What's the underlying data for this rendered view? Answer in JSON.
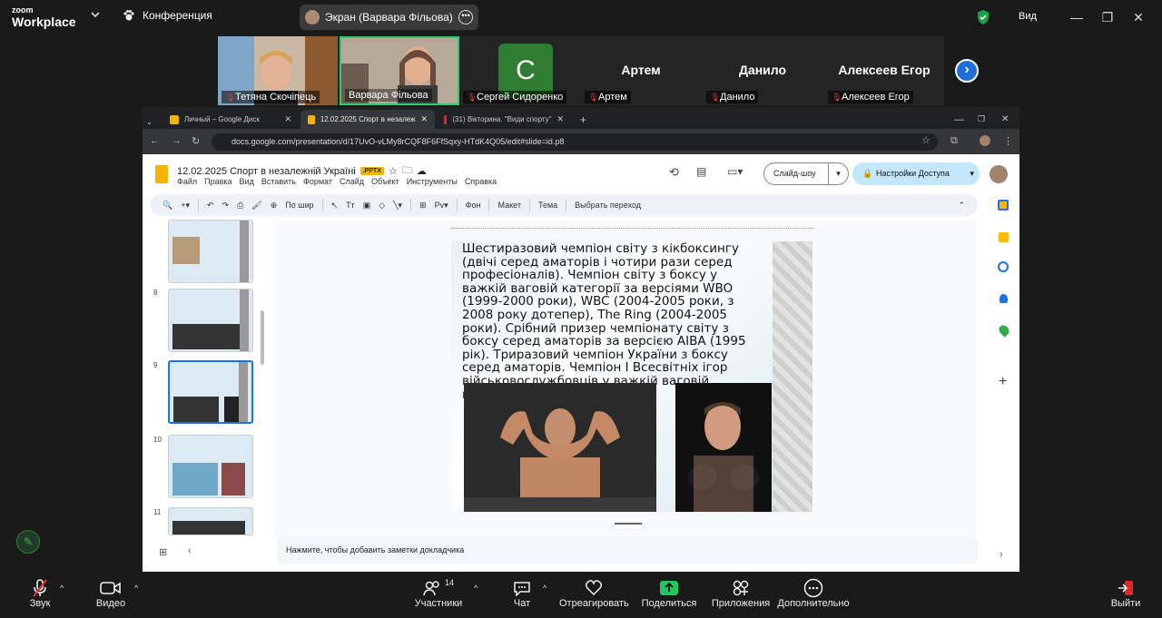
{
  "zoom": {
    "logo_top": "zoom",
    "logo_bottom": "Workplace",
    "meeting_title": "Конференция",
    "screen_share_label": "Экран (Варвара Фільова)",
    "view_label": "Вид",
    "participants": [
      {
        "name": "Тетяна Скочіпець",
        "muted": true,
        "video": true
      },
      {
        "name": "Варвара Фільова",
        "muted": false,
        "video": true,
        "active_speaker": true
      },
      {
        "name": "Сергей Сидоренко",
        "muted": true,
        "avatar_letter": "С"
      },
      {
        "name": "Артем",
        "muted": true
      },
      {
        "name": "Данило",
        "muted": true
      },
      {
        "name": "Алексеев Егор",
        "muted": true
      }
    ],
    "toolbar": {
      "audio": "Звук",
      "video": "Видео",
      "participants": "Участники",
      "participants_count": "14",
      "chat": "Чат",
      "react": "Отреагировать",
      "share": "Поделиться",
      "apps": "Приложения",
      "more": "Дополнительно",
      "leave": "Выйти"
    },
    "colors": {
      "accent": "#1e6fd9",
      "share_green": "#22c55e",
      "leave_red": "#e02828"
    }
  },
  "browser": {
    "tabs": [
      {
        "title": "Личный – Google Диск",
        "icon": "drive-icon"
      },
      {
        "title": "12.02.2025 Спорт в незалеж",
        "icon": "slides-icon",
        "active": true
      },
      {
        "title": "(31) Вікторина. \"Види спорту\"",
        "icon": "youtube-icon"
      }
    ],
    "url": "docs.google.com/presentation/d/17UvO-vLMy8rCQF8F6FfSqxy-HTdK4Q05/edit#slide=id.p8"
  },
  "slides": {
    "doc_title": "12.02.2025  Спорт в незалежній Україні",
    "badge": ".PPTX",
    "menu": [
      "Файл",
      "Правка",
      "Вид",
      "Вставить",
      "Формат",
      "Слайд",
      "Объект",
      "Инструменты",
      "Справка"
    ],
    "slideshow_label": "Слайд-шоу",
    "share_label": "Настройки Доступа",
    "toolbar": {
      "zoom_label": "По шир",
      "background": "Фон",
      "layout": "Макет",
      "theme": "Тема",
      "transition": "Выбрать переход"
    },
    "thumbnails": [
      {
        "number": "",
        "selected": false
      },
      {
        "number": "8",
        "selected": false
      },
      {
        "number": "9",
        "selected": true
      },
      {
        "number": "10",
        "selected": false
      },
      {
        "number": "11",
        "selected": false
      }
    ],
    "slide_text": "Шестиразовий чемпіон світу з кікбоксингу (двічі серед аматорів і чотири рази серед професіоналів). Чемпіон світу з боксу у важкій ваговій категорії за версіями WBO (1999-2000 роки), WBC (2004-2005 роки, з 2008 року дотепер), The Ring (2004-2005 роки). Срібний призер чемпіонату світу з боксу серед аматорів за версією AIBA (1995 рік). Триразовий чемпіон України з боксу серед аматорів. Чемпіон І Всесвітніх ігор військовослужбовців у важкій ваговій категорії (1995 рік).",
    "notes_placeholder": "Нажмите, чтобы добавить заметки докладчика"
  }
}
